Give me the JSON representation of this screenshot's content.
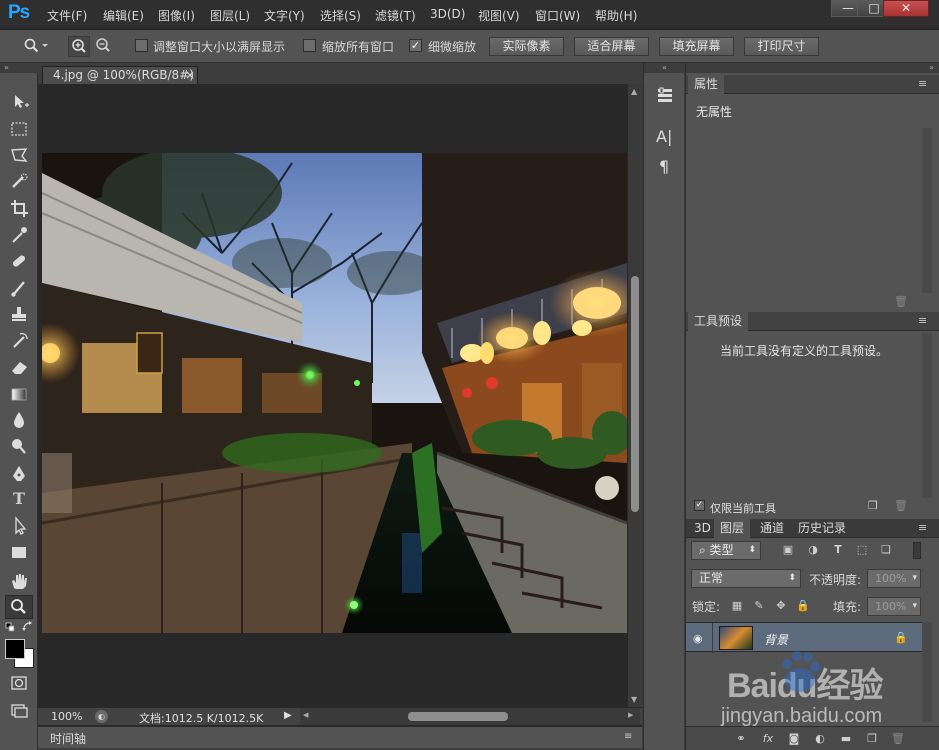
{
  "app": {
    "logo": "Ps"
  },
  "menu": [
    "文件(F)",
    "编辑(E)",
    "图像(I)",
    "图层(L)",
    "文字(Y)",
    "选择(S)",
    "滤镜(T)",
    "3D(D)",
    "视图(V)",
    "窗口(W)",
    "帮助(H)"
  ],
  "window_controls": {
    "minimize": "—",
    "maximize": "□",
    "close": "✕"
  },
  "options": {
    "fit_window": {
      "label": "调整窗口大小以满屏显示",
      "checked": false
    },
    "zoom_all": {
      "label": "缩放所有窗口",
      "checked": false
    },
    "scrubby": {
      "label": "细微缩放",
      "checked": true
    },
    "actual_pixels": "实际像素",
    "fit_screen": "适合屏幕",
    "fill_screen": "填充屏幕",
    "print_size": "打印尺寸"
  },
  "document": {
    "tab_title": "4.jpg @ 100%(RGB/8#)",
    "tab_close": "×",
    "zoom": "100%",
    "doc_info": "文档:1012.5 K/1012.5K",
    "timeline": "时间轴"
  },
  "properties": {
    "tab": "属性",
    "text": "无属性"
  },
  "tool_presets": {
    "tab": "工具预设",
    "text": "当前工具没有定义的工具预设。",
    "current_only": {
      "label": "仅限当前工具",
      "checked": true
    }
  },
  "layers_panel": {
    "tabs": [
      "3D",
      "图层",
      "通道",
      "历史记录"
    ],
    "active_tab": "图层",
    "filter": "类型",
    "blend": "正常",
    "opacity_label": "不透明度:",
    "opacity_value": "100%",
    "lock_label": "锁定:",
    "fill_label": "填充:",
    "fill_value": "100%",
    "layers": [
      {
        "name": "背景",
        "locked": true,
        "visible": true
      }
    ]
  },
  "watermark": {
    "brand": "Baidu经验",
    "url": "jingyan.baidu.com"
  },
  "colors": {
    "ps_blue": "#2aa4ff",
    "panel_gray": "#535353",
    "dark_gray": "#282828",
    "layer_selected": "#5d6b7c",
    "baidu_blue": "#2b6fd6"
  }
}
